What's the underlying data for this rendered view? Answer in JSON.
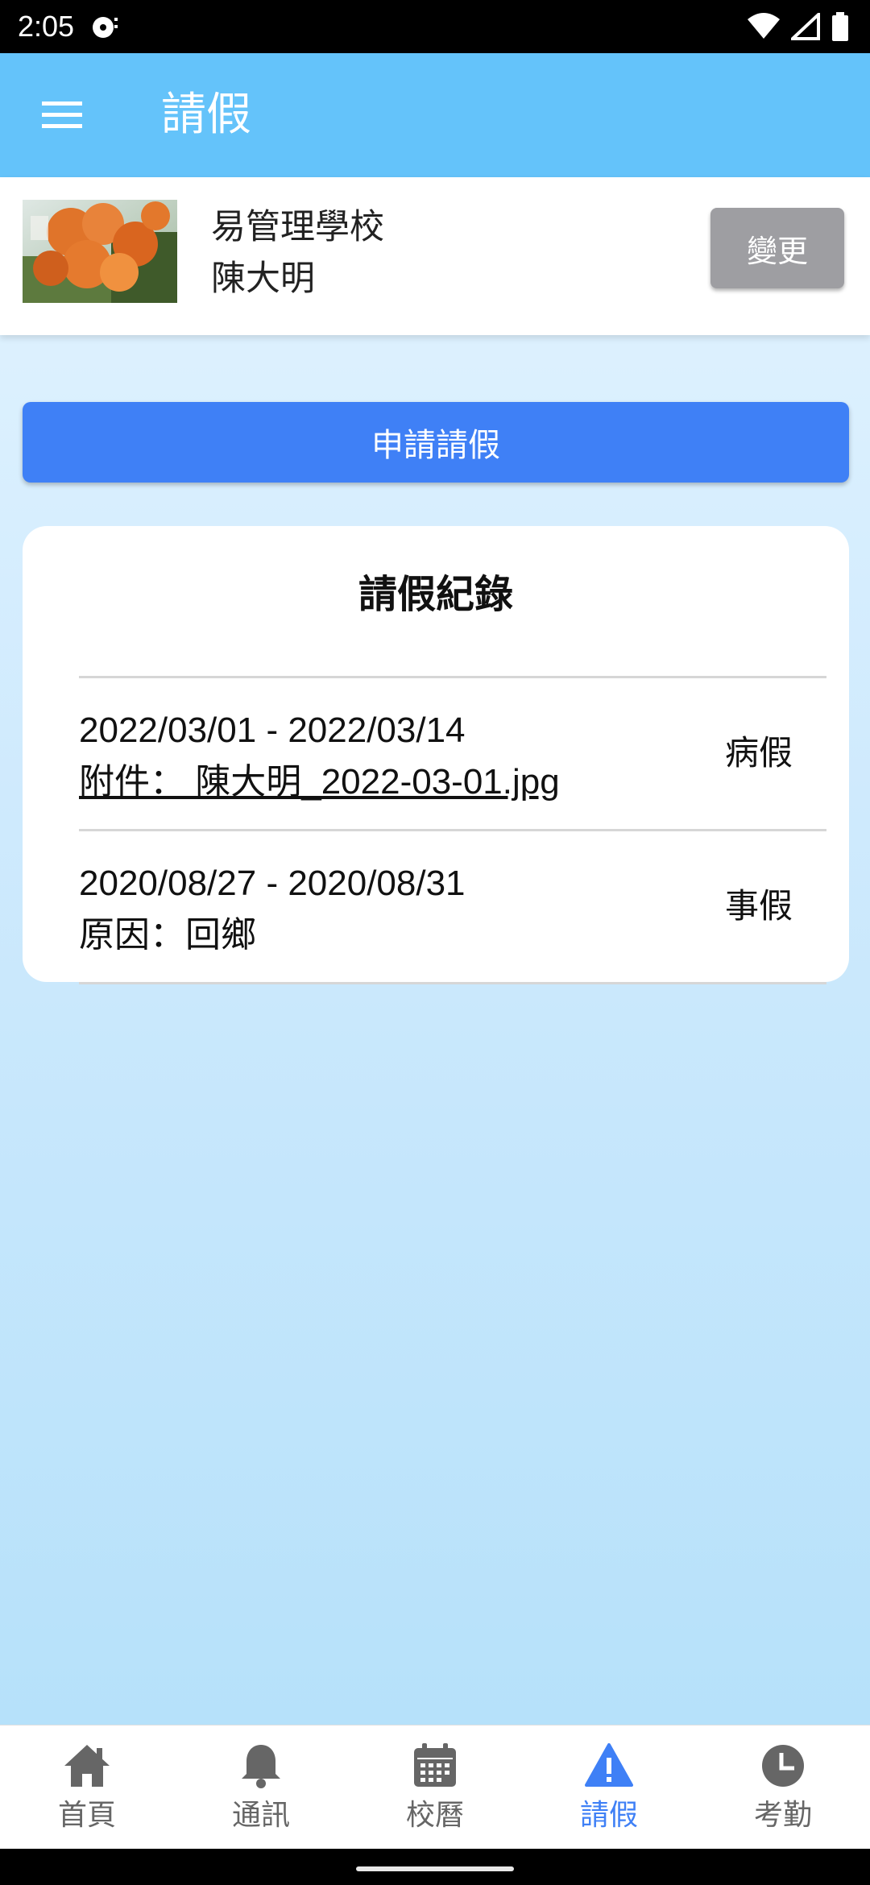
{
  "status_bar": {
    "time": "2:05"
  },
  "app_bar": {
    "title": "請假"
  },
  "profile": {
    "school": "易管理學校",
    "student": "陳大明",
    "change_label": "變更"
  },
  "apply_button_label": "申請請假",
  "records": {
    "title": "請假紀錄",
    "items": [
      {
        "dates": "2022/03/01 - 2022/03/14",
        "detail": "附件： 陳大明_2022-03-01.jpg",
        "type": "病假"
      },
      {
        "dates": "2020/08/27 - 2020/08/31",
        "detail": "原因：回鄉",
        "type": "事假"
      }
    ]
  },
  "bottom_nav": {
    "items": [
      {
        "label": "首頁",
        "icon": "home-icon"
      },
      {
        "label": "通訊",
        "icon": "bell-icon"
      },
      {
        "label": "校曆",
        "icon": "calendar-icon"
      },
      {
        "label": "請假",
        "icon": "alert-icon",
        "active": true
      },
      {
        "label": "考勤",
        "icon": "clock-icon"
      }
    ]
  },
  "colors": {
    "app_bar": "#64c3fa",
    "primary_button": "#3f80f6",
    "change_button": "#9e9ea2",
    "active_nav": "#3f80f6"
  }
}
